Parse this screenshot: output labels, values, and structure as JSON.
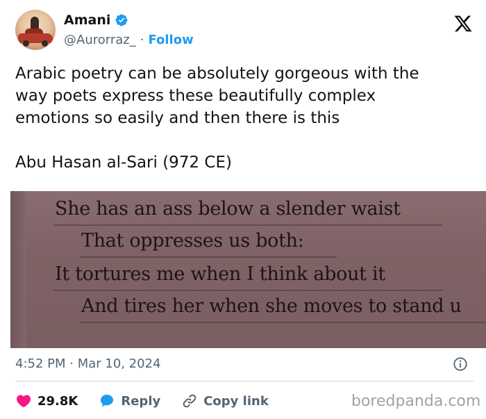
{
  "header": {
    "display_name": "Amani",
    "handle": "@Aurorraz_",
    "separator": "·",
    "follow_label": "Follow"
  },
  "tweet": {
    "text": "Arabic poetry can be absolutely gorgeous with the\nway poets express these beautifully complex\nemotions so easily and then there is this\n\nAbu Hasan al-Sari (972 CE)"
  },
  "media": {
    "poem_lines": [
      "She has an ass below a slender waist",
      "That oppresses us both:",
      "It tortures me when I think about it",
      "And tires her when she moves to stand u"
    ]
  },
  "meta": {
    "timestamp": "4:52 PM · Mar 10, 2024"
  },
  "actions": {
    "likes_count": "29.8K",
    "reply_label": "Reply",
    "copy_link_label": "Copy link"
  },
  "watermark": "boredpanda.com",
  "colors": {
    "accent": "#1d9bf0",
    "like": "#f91880",
    "muted": "#536471"
  },
  "icons": [
    "verified-badge-icon",
    "x-logo-icon",
    "info-icon",
    "heart-icon",
    "reply-bubble-icon",
    "link-icon"
  ]
}
